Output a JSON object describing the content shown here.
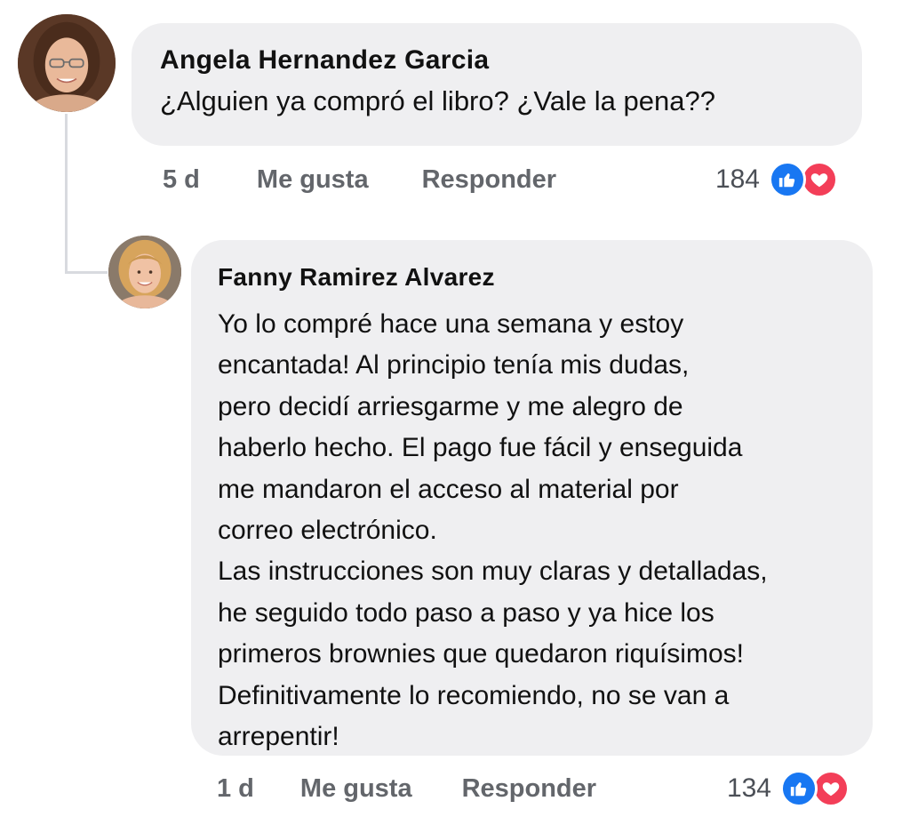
{
  "comments": [
    {
      "author": "Angela Hernandez Garcia",
      "text": "¿Alguien ya compró el libro? ¿Vale la pena??",
      "time": "5 d",
      "like_label": "Me gusta",
      "reply_label": "Responder",
      "reaction_count": "184",
      "reactions": [
        "like-icon",
        "love-icon"
      ]
    },
    {
      "author": "Fanny Ramirez Alvarez",
      "text": "Yo lo compré hace una semana y estoy\nencantada! Al principio tenía mis dudas,\npero decidí arriesgarme y me alegro de\nhaberlo hecho. El pago fue fácil y enseguida\nme mandaron el acceso al material por\ncorreo electrónico.\nLas instrucciones son muy claras y detalladas,\nhe seguido todo paso a paso y ya hice los\nprimeros brownies que quedaron riquísimos!\nDefinitivamente lo recomiendo, no se van a\narrepentir!",
      "time": "1 d",
      "like_label": "Me gusta",
      "reply_label": "Responder",
      "reaction_count": "134",
      "reactions": [
        "like-icon",
        "love-icon"
      ]
    }
  ],
  "colors": {
    "bubble_bg": "#efeff1",
    "action_text": "#63666b",
    "like_blue": "#1877f2",
    "love_red": "#f33e58",
    "thread_line": "#d8dadf"
  }
}
